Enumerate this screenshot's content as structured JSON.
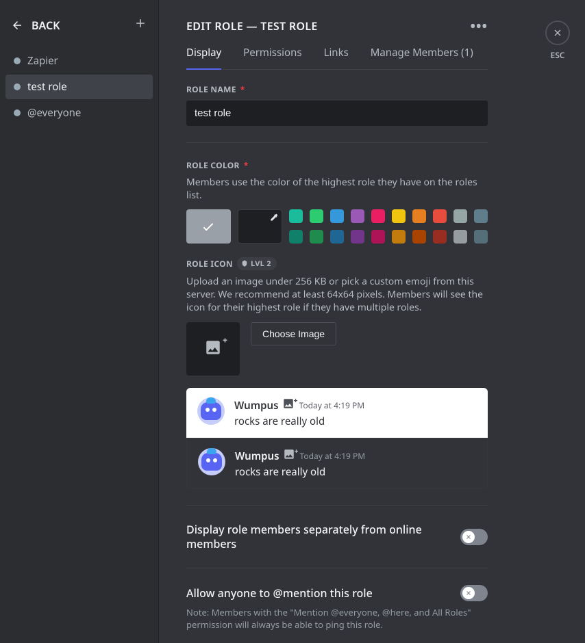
{
  "back_label": "BACK",
  "sidebar": {
    "roles": [
      {
        "label": "Zapier"
      },
      {
        "label": "test role"
      },
      {
        "label": "@everyone"
      }
    ],
    "selected_index": 1
  },
  "header": {
    "title": "EDIT ROLE — TEST ROLE"
  },
  "tabs": {
    "items": [
      "Display",
      "Permissions",
      "Links",
      "Manage Members (1)"
    ],
    "active_index": 0
  },
  "role_name": {
    "label": "ROLE NAME",
    "value": "test role"
  },
  "role_color": {
    "label": "ROLE COLOR",
    "helper": "Members use the color of the highest role they have on the roles list.",
    "default_color": "#99a0a7",
    "colors_row1": [
      "#1abc9c",
      "#2ecc71",
      "#3498db",
      "#9b59b6",
      "#e91e63",
      "#f1c40f",
      "#e67e22",
      "#e74c3c",
      "#95a5a6",
      "#607d8b"
    ],
    "colors_row2": [
      "#11806a",
      "#1f8b4c",
      "#206694",
      "#71368a",
      "#ad1457",
      "#c27c0e",
      "#a84300",
      "#992d22",
      "#979c9f",
      "#546e7a"
    ]
  },
  "role_icon": {
    "label": "ROLE ICON",
    "badge": "LVL 2",
    "helper": "Upload an image under 256 KB or pick a custom emoji from this server. We recommend at least 64x64 pixels. Members will see the icon for their highest role if they have multiple roles.",
    "choose_label": "Choose Image"
  },
  "preview": {
    "username": "Wumpus",
    "timestamp": "Today at 4:19 PM",
    "message": "rocks are really old"
  },
  "toggle_display_separately": {
    "label": "Display role members separately from online members",
    "on": false
  },
  "toggle_mention": {
    "label": "Allow anyone to @mention this role",
    "on": false,
    "note": "Note: Members with the \"Mention @everyone, @here, and All Roles\" permission will always be able to ping this role."
  },
  "close": {
    "label": "ESC"
  }
}
